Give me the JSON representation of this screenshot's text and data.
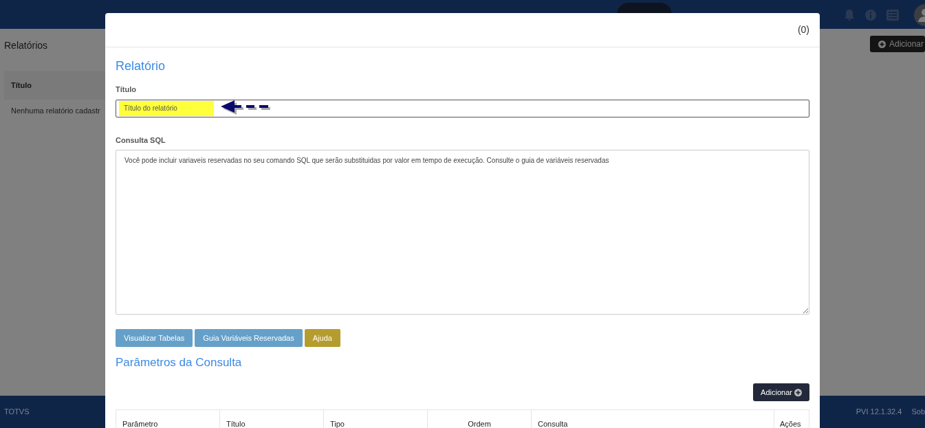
{
  "page": {
    "title": "Relatórios",
    "add_button": "Adicionar",
    "column": "Título",
    "empty_message": "Nenhuma relatório cadastr"
  },
  "footer": {
    "brand": "TOTVS",
    "version": "PVI 12.1.32.4",
    "link": "Sob"
  },
  "modal": {
    "count": "(0)",
    "heading": "Relatório",
    "title_field": {
      "label": "Título",
      "placeholder": "Título do relatório"
    },
    "sql_field": {
      "label": "Consulta SQL",
      "placeholder": "Você pode incluir variaveis reservadas no seu comando SQL que serão substituidas por valor em tempo de execução. Consulte o guia de variáveis reservadas"
    },
    "buttons": [
      {
        "label": "Visualizar Tabelas",
        "kind": "info"
      },
      {
        "label": "Guia Variáveis Reservadas",
        "kind": "info"
      },
      {
        "label": "Ajuda",
        "kind": "warning"
      }
    ],
    "params_heading": "Parâmetros da Consulta",
    "params_add_button": "Adicionar",
    "table": {
      "columns": [
        "Parâmetro",
        "Título",
        "Tipo",
        "Ordem",
        "Consulta",
        "Ações"
      ]
    }
  }
}
